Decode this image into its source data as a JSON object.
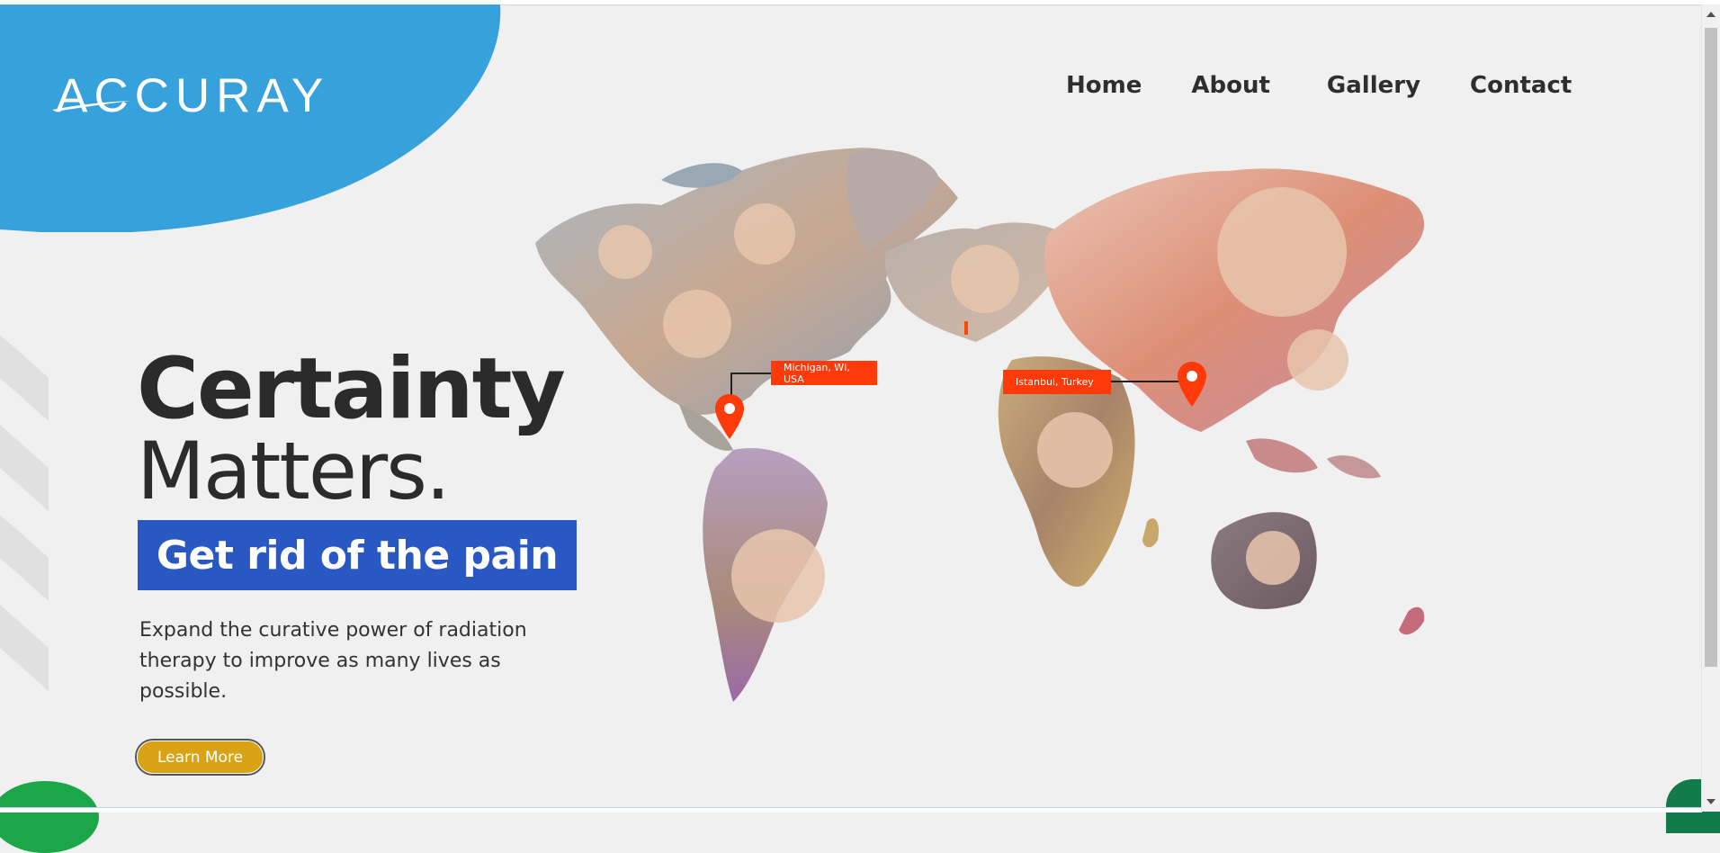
{
  "brand": {
    "logo_text": "ACCURAY",
    "blue": "#37a1dc"
  },
  "nav": {
    "items": [
      {
        "label": "Home"
      },
      {
        "label": "About"
      },
      {
        "label": "Gallery"
      },
      {
        "label": "Contact"
      }
    ]
  },
  "hero": {
    "title_line1": "Certainty",
    "title_line2": "Matters.",
    "banner": "Get rid of the pain",
    "banner_color": "#2a58c3",
    "description": "Expand the curative power of radiation therapy to improve as many lives as possible.",
    "cta_label": "Learn More",
    "cta_color": "#d9a315"
  },
  "map": {
    "pins": [
      {
        "label": "Michigan, WI, USA"
      },
      {
        "label": "Istanbul, Turkey"
      }
    ],
    "pin_color": "#ff3a0a"
  }
}
